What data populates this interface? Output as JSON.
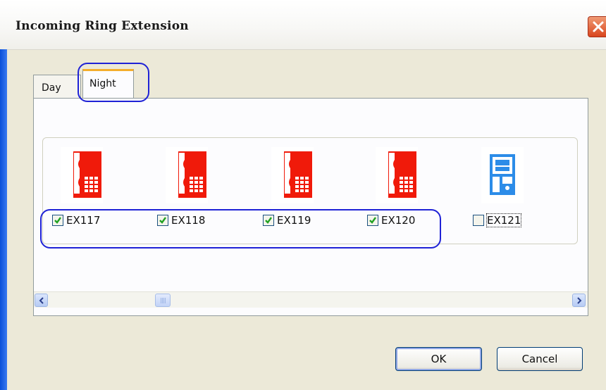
{
  "window": {
    "title": "Incoming Ring Extension"
  },
  "tabs": [
    {
      "label": "Day",
      "selected": false
    },
    {
      "label": "Night",
      "selected": true
    }
  ],
  "extensions": [
    {
      "label": "EX117",
      "checked": true,
      "icon": "desk-phone-icon",
      "color": "#f01a0a"
    },
    {
      "label": "EX118",
      "checked": true,
      "icon": "desk-phone-icon",
      "color": "#f01a0a"
    },
    {
      "label": "EX119",
      "checked": true,
      "icon": "desk-phone-icon",
      "color": "#f01a0a"
    },
    {
      "label": "EX120",
      "checked": true,
      "icon": "desk-phone-icon",
      "color": "#f01a0a"
    },
    {
      "label": "EX121",
      "checked": false,
      "icon": "door-phone-icon",
      "color": "#2c8ce8"
    }
  ],
  "buttons": {
    "ok": "OK",
    "cancel": "Cancel"
  },
  "colors": {
    "highlight": "#1f22d6",
    "active_tab": "#f4ae2c"
  }
}
